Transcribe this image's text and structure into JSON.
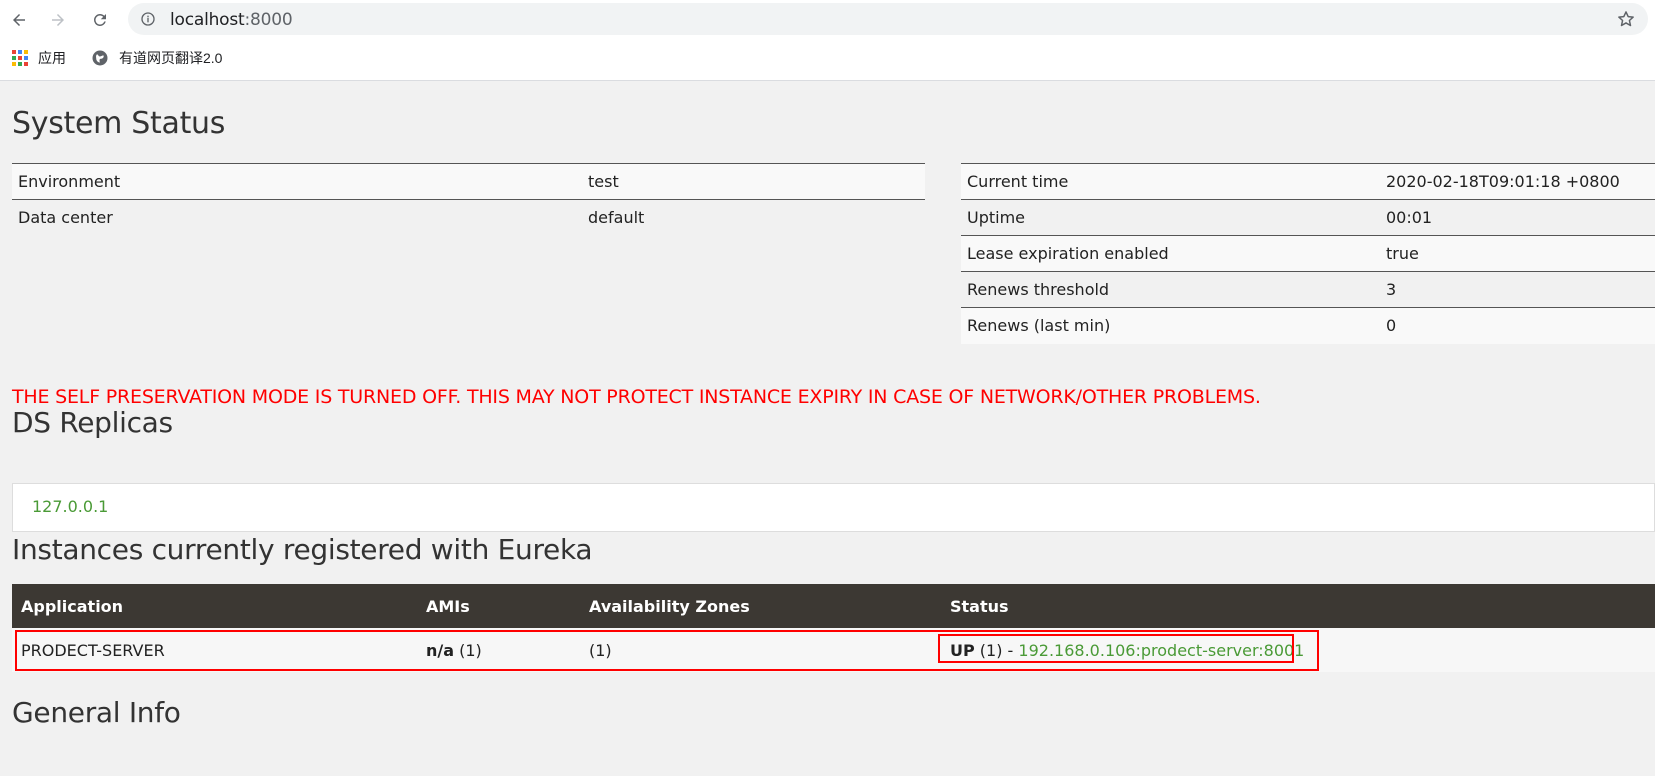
{
  "browser": {
    "url_host": "localhost",
    "url_port": ":8000",
    "bookmarks": [
      {
        "label": "应用",
        "icon": "apps-grid-icon"
      },
      {
        "label": "有道网页翻译2.0",
        "icon": "globe-icon"
      }
    ]
  },
  "system_status": {
    "title": "System Status",
    "left": [
      {
        "key": "Environment",
        "value": "test"
      },
      {
        "key": "Data center",
        "value": "default"
      }
    ],
    "right": [
      {
        "key": "Current time",
        "value": "2020-02-18T09:01:18 +0800"
      },
      {
        "key": "Uptime",
        "value": "00:01"
      },
      {
        "key": "Lease expiration enabled",
        "value": "true"
      },
      {
        "key": "Renews threshold",
        "value": "3"
      },
      {
        "key": "Renews (last min)",
        "value": "0"
      }
    ]
  },
  "warning": "THE SELF PRESERVATION MODE IS TURNED OFF. THIS MAY NOT PROTECT INSTANCE EXPIRY IN CASE OF NETWORK/OTHER PROBLEMS.",
  "ds_replicas": {
    "title": "DS Replicas",
    "items": [
      "127.0.0.1"
    ]
  },
  "instances": {
    "title": "Instances currently registered with Eureka",
    "headers": [
      "Application",
      "AMIs",
      "Availability Zones",
      "Status"
    ],
    "rows": [
      {
        "application": "PRODECT-SERVER",
        "amis_bold": "n/a",
        "amis_count": " (1)",
        "zones": "(1)",
        "status_bold": "UP",
        "status_count": " (1) - ",
        "status_link": "192.168.0.106:prodect-server:8001"
      }
    ]
  },
  "general_info": {
    "title": "General Info"
  },
  "colors": {
    "warning": "#ff0000",
    "link_green": "#4a9a36",
    "table_header": "#3c3833",
    "highlight_box": "#ff0000"
  }
}
